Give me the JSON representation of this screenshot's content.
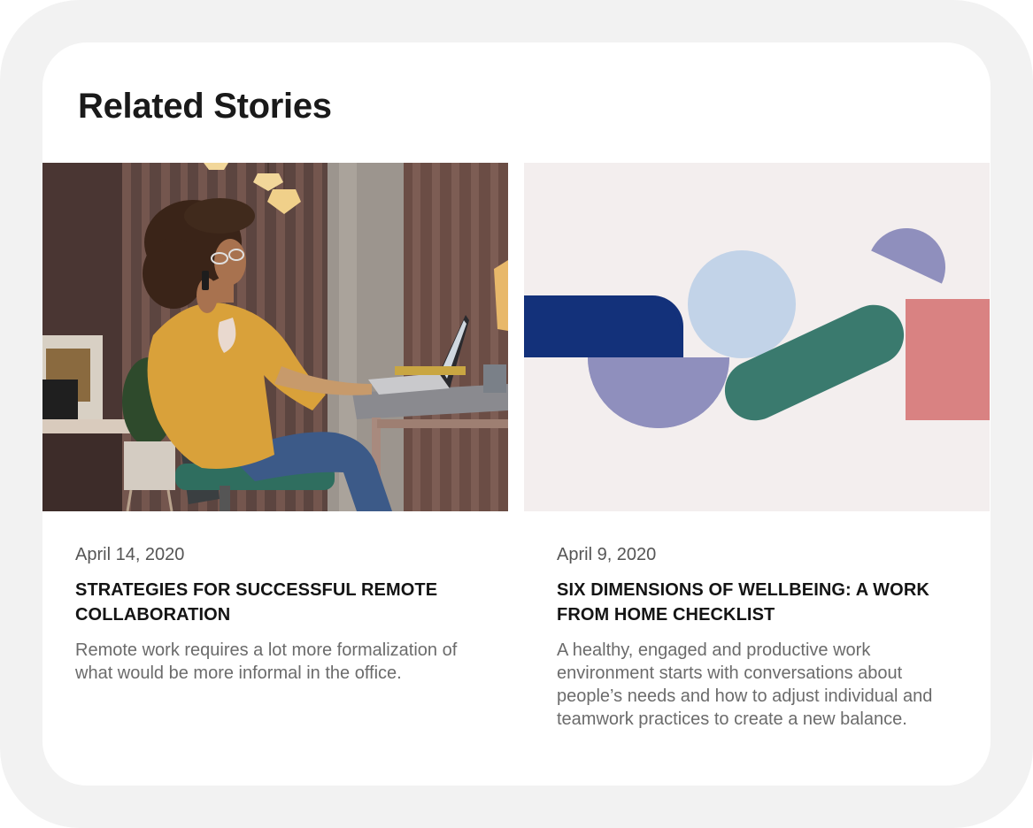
{
  "section": {
    "title": "Related Stories"
  },
  "stories": [
    {
      "date": "April 14, 2020",
      "title": "STRATEGIES FOR SUCCESSFUL REMOTE COLLABORATION",
      "summary": "Remote work requires a lot more formalization of what would be more informal in the office.",
      "image": "woman-on-phone-at-laptop-photo"
    },
    {
      "date": "April 9, 2020",
      "title": "SIX DIMENSIONS OF WELLBEING: A WORK FROM HOME CHECKLIST",
      "summary": "A healthy, engaged and productive work environment starts with conversations about people’s needs and how to adjust individual and teamwork practices to create a new balance.",
      "image": "abstract-shapes-illustration"
    }
  ],
  "colors": {
    "frame": "#f2f2f2",
    "card": "#ffffff",
    "title": "#1a1a1a",
    "date": "#555555",
    "summary": "#6b6b6b",
    "navy": "#13317a",
    "lavender": "#8f8fbd",
    "light_blue": "#c2d3e8",
    "teal": "#3a7a6e",
    "salmon": "#d98282",
    "illustration_bg": "#f3eeee"
  }
}
